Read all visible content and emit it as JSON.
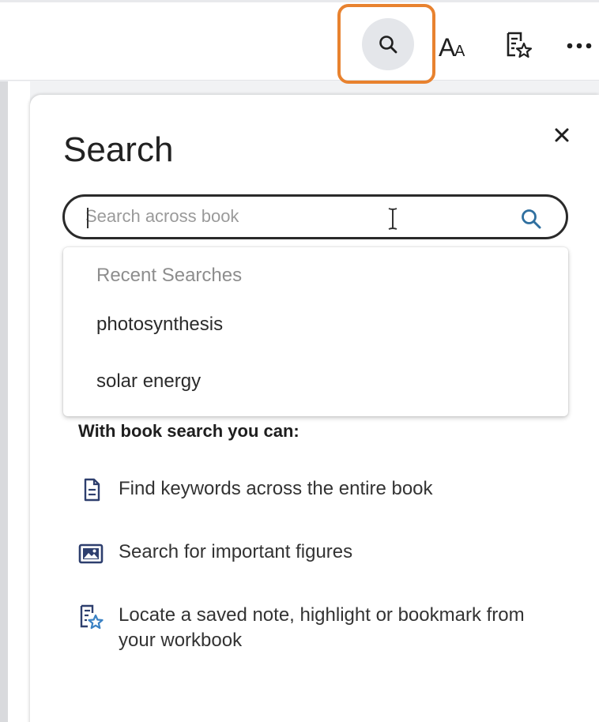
{
  "toolbar": {
    "search_icon": "search-icon",
    "font_size_icon": "font-size-icon",
    "notes_icon": "notes-star-icon",
    "more_icon": "more-horizontal-icon",
    "focus_color": "#e8822f"
  },
  "panel": {
    "title": "Search",
    "close_icon": "close-icon",
    "search": {
      "placeholder": "Search across book",
      "value": ""
    },
    "recent": {
      "header": "Recent Searches",
      "items": [
        "photosynthesis",
        "solar energy"
      ]
    },
    "info": {
      "heading": "With book search you can:",
      "features": [
        {
          "icon": "document-icon",
          "text": "Find keywords across the entire book"
        },
        {
          "icon": "image-icon",
          "text": "Search for important figures"
        },
        {
          "icon": "notes-star-icon",
          "text": "Locate a saved note, highlight or bookmark from your workbook"
        }
      ]
    }
  },
  "colors": {
    "accent_blue": "#2f6f9f",
    "icon_navy": "#2e3f6e",
    "star_blue": "#3b82c4"
  }
}
